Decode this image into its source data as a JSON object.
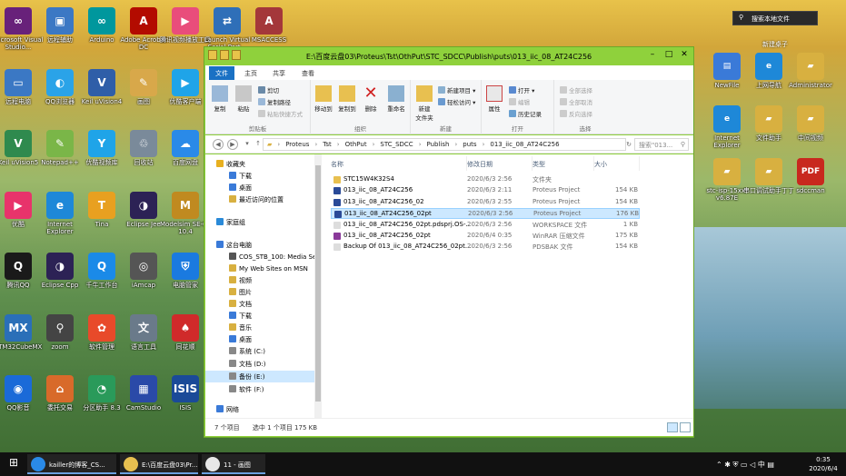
{
  "desktop": {
    "icons": [
      {
        "label": "Microsoft Visual Studio...",
        "icon": "visual-studio-icon",
        "color": "#68217a",
        "glyph": "∞"
      },
      {
        "label": "远程辅助",
        "icon": "remote-assist-icon",
        "color": "#3b78c4",
        "glyph": "▣"
      },
      {
        "label": "Arduino",
        "icon": "arduino-icon",
        "color": "#00979d",
        "glyph": "∞"
      },
      {
        "label": "Adobe Acrobat DC",
        "icon": "acrobat-icon",
        "color": "#b30b00",
        "glyph": "A"
      },
      {
        "label": "腾讯视频播放工具",
        "icon": "video-tool-icon",
        "color": "#e94d7b",
        "glyph": "▶"
      },
      {
        "label": "Launch Virtual Serial Port...",
        "icon": "serial-port-icon",
        "color": "#2f6fb8",
        "glyph": "⇄"
      },
      {
        "label": "MSACCESS",
        "icon": "access-icon",
        "color": "#a4373a",
        "glyph": "A"
      },
      {
        "label": "远程电脑",
        "icon": "computer-icon",
        "color": "#3b78c4",
        "glyph": "▭"
      },
      {
        "label": "QQ浏览器",
        "icon": "qq-browser-icon",
        "color": "#2aa3e8",
        "glyph": "◐"
      },
      {
        "label": "Keil uVision4",
        "icon": "keil4-icon",
        "color": "#2f5ea8",
        "glyph": "V"
      },
      {
        "label": "画图",
        "icon": "paint-icon",
        "color": "#d8a84a",
        "glyph": "✎"
      },
      {
        "label": "优酷客户端",
        "icon": "youku-icon",
        "color": "#1fa4e8",
        "glyph": "▶"
      },
      {
        "label": "网络",
        "icon": "network-icon",
        "color": "#3b78c4",
        "glyph": "◍"
      },
      {
        "label": "Macromedia Dreamweav...",
        "icon": "dreamweaver-icon",
        "color": "#3d9a3a",
        "glyph": "◉"
      },
      {
        "label": "Keil uVision5",
        "icon": "keil5-icon",
        "color": "#2f8a4e",
        "glyph": "V"
      },
      {
        "label": "Notepad++",
        "icon": "notepad-icon",
        "color": "#7ab648",
        "glyph": "✎"
      },
      {
        "label": "优酷视频库",
        "icon": "youku-lib-icon",
        "color": "#1fa4e8",
        "glyph": "Y"
      },
      {
        "label": "回收站",
        "icon": "recycle-bin-icon",
        "color": "#7a8a9a",
        "glyph": "♲"
      },
      {
        "label": "百度网盘",
        "icon": "baidu-netdisk-icon",
        "color": "#2a8ae8",
        "glyph": "☁"
      },
      {
        "label": "phpstudy_pro",
        "icon": "phpstudy-icon",
        "color": "#1c6fd8",
        "glyph": "P"
      },
      {
        "label": "Quartus II 13.0sp1 (64...",
        "icon": "quartus-icon",
        "color": "#2a63c2",
        "glyph": "Q"
      },
      {
        "label": "优酷",
        "icon": "youku2-icon",
        "color": "#e8336b",
        "glyph": "▶"
      },
      {
        "label": "Internet Explorer",
        "icon": "ie-icon",
        "color": "#1e88d8",
        "glyph": "e"
      },
      {
        "label": "Tina",
        "icon": "tina-icon",
        "color": "#e8a020",
        "glyph": "T"
      },
      {
        "label": "Eclipse Jee",
        "icon": "eclipse-jee-icon",
        "color": "#2c2255",
        "glyph": "◑"
      },
      {
        "label": "Modelsim SE-64 10.4",
        "icon": "modelsim-icon",
        "color": "#c08a20",
        "glyph": "M"
      },
      {
        "label": "QQ音乐",
        "icon": "qq-music-icon",
        "color": "#31c27c",
        "glyph": "♪"
      },
      {
        "label": "远程连接",
        "icon": "remote-connect-icon",
        "color": "#3b78c4",
        "glyph": "⇆"
      },
      {
        "label": "腾讯QQ",
        "icon": "qq-icon",
        "color": "#1a1a1a",
        "glyph": "Q"
      },
      {
        "label": "Eclipse Cpp",
        "icon": "eclipse-cpp-icon",
        "color": "#2c2255",
        "glyph": "◑"
      },
      {
        "label": "千牛工作台",
        "icon": "qianniu-icon",
        "color": "#1a8ae8",
        "glyph": "Q"
      },
      {
        "label": "iAmcap",
        "icon": "amcap-icon",
        "color": "#555555",
        "glyph": "◎"
      },
      {
        "label": "电脑管家",
        "icon": "pc-manager-icon",
        "color": "#1a7ae0",
        "glyph": "⛨"
      },
      {
        "label": "腾讯课堂",
        "icon": "tencent-class-icon",
        "color": "#2a9ae8",
        "glyph": "▶"
      },
      {
        "label": "同花顺远航版",
        "icon": "tonghuashun-icon",
        "color": "#d02a2a",
        "glyph": "♠"
      },
      {
        "label": "STM32CubeMX",
        "icon": "stm32cube-icon",
        "color": "#2a6fb8",
        "glyph": "MX"
      },
      {
        "label": "zoom",
        "icon": "zoom-icon",
        "color": "#444444",
        "glyph": "⚲"
      },
      {
        "label": "软件管理",
        "icon": "software-manager-icon",
        "color": "#e84a2a",
        "glyph": "✿"
      },
      {
        "label": "语言工具",
        "icon": "language-tool-icon",
        "color": "#6a7a8a",
        "glyph": "文"
      },
      {
        "label": "同花顺",
        "icon": "tonghuashun2-icon",
        "color": "#d02a2a",
        "glyph": "♠"
      },
      {
        "label": "网易有道词典",
        "icon": "youdao-icon",
        "color": "#e02a2a",
        "glyph": "有道"
      },
      {
        "label": "视频编辑专家 9.3",
        "icon": "video-editor-icon",
        "color": "#333333",
        "glyph": "◈"
      },
      {
        "label": "QQ影音",
        "icon": "qq-player-icon",
        "color": "#1a6ad8",
        "glyph": "◉"
      },
      {
        "label": "委托交易",
        "icon": "trade-icon",
        "color": "#d86a2a",
        "glyph": "⌂"
      },
      {
        "label": "分区助手 8.3",
        "icon": "partition-icon",
        "color": "#2a9a5a",
        "glyph": "◔"
      },
      {
        "label": "CamStudio",
        "icon": "camstudio-icon",
        "color": "#2a4aa8",
        "glyph": "▦"
      },
      {
        "label": "ISIS",
        "icon": "isis-icon",
        "color": "#1a4a98",
        "glyph": "ISIS"
      },
      {
        "label": "Proteus 8 Professional",
        "icon": "proteus-icon",
        "color": "#2a6ab8",
        "glyph": "P"
      }
    ],
    "right_icons": [
      {
        "label": "NewFile",
        "icon": "new-file-icon",
        "color": "#3a7ad8",
        "glyph": "▤"
      },
      {
        "label": "上网导航",
        "icon": "ie-nav-icon",
        "color": "#1e88d8",
        "glyph": "e"
      },
      {
        "label": "Administrator",
        "icon": "admin-folder-icon",
        "color": "#d8b040",
        "glyph": "▰"
      },
      {
        "label": "Internet Explorer",
        "icon": "ie2-icon",
        "color": "#1e88d8",
        "glyph": "e"
      },
      {
        "label": "文件助手",
        "icon": "file-helper-icon",
        "color": "#d8b040",
        "glyph": "▰"
      },
      {
        "label": "中间视频",
        "icon": "video-folder-icon",
        "color": "#d8b040",
        "glyph": "▰"
      },
      {
        "label": "stc-isp-15xx-v6.87E",
        "icon": "stc-isp-folder-icon",
        "color": "#d8b040",
        "glyph": "▰"
      },
      {
        "label": "串口调试助手丁丁",
        "icon": "serial-debug-folder-icon",
        "color": "#d8b040",
        "glyph": "▰"
      },
      {
        "label": "sdccman",
        "icon": "pdf-icon",
        "color": "#c8281e",
        "glyph": "PDF"
      }
    ],
    "search_box": "搜索本地文件",
    "right_title": "新建桌子"
  },
  "window": {
    "title": "E:\\百度云盘03\\Proteus\\Tst\\OthPut\\STC_SDCC\\Publish\\puts\\013_iic_08_AT24C256",
    "tabs": [
      "文件",
      "主页",
      "共享",
      "查看"
    ],
    "ribbon": {
      "groups": {
        "clipboard": "剪贴板",
        "organize": "组织",
        "new": "新建",
        "open": "打开",
        "select": "选择"
      },
      "copy": "复制",
      "paste": "粘贴",
      "cut": "剪切",
      "copy_path": "复制路径",
      "paste_shortcut": "粘贴快捷方式",
      "move_to": "移动到",
      "copy_to": "复制到",
      "delete": "删除",
      "rename": "重命名",
      "new_folder": "新建\n文件夹",
      "new_item": "新建项目",
      "easy_access": "轻松访问",
      "properties": "属性",
      "open": "打开",
      "edit": "编辑",
      "history": "历史记录",
      "select_all": "全部选择",
      "select_none": "全部取消",
      "invert": "反向选择"
    },
    "path": [
      "Proteus",
      "Tst",
      "OthPut",
      "STC_SDCC",
      "Publish",
      "puts",
      "013_iic_08_AT24C256"
    ],
    "search_placeholder": "搜索\"013...",
    "nav": [
      {
        "label": "收藏夹",
        "icon": "star-icon",
        "color": "#e8b020",
        "indent": 0
      },
      {
        "label": "下载",
        "icon": "download-icon",
        "color": "#3a7ad8",
        "indent": 1
      },
      {
        "label": "桌面",
        "icon": "desktop-icon",
        "color": "#3a7ad8",
        "indent": 1
      },
      {
        "label": "最近访问的位置",
        "icon": "recent-icon",
        "color": "#d8b040",
        "indent": 1
      },
      {
        "label": "家庭组",
        "icon": "homegroup-icon",
        "color": "#2a8ad8",
        "indent": 0
      },
      {
        "label": "这台电脑",
        "icon": "this-pc-icon",
        "color": "#3a7ad8",
        "indent": 0
      },
      {
        "label": "COS_STB_100: Media Serv",
        "icon": "media-server-icon",
        "color": "#555555",
        "indent": 1
      },
      {
        "label": "My Web Sites on MSN",
        "icon": "msn-icon",
        "color": "#d8b040",
        "indent": 1
      },
      {
        "label": "视频",
        "icon": "videos-icon",
        "color": "#d8b040",
        "indent": 1
      },
      {
        "label": "图片",
        "icon": "pictures-icon",
        "color": "#d8b040",
        "indent": 1
      },
      {
        "label": "文档",
        "icon": "documents-icon",
        "color": "#d8b040",
        "indent": 1
      },
      {
        "label": "下载",
        "icon": "downloads-icon",
        "color": "#3a7ad8",
        "indent": 1
      },
      {
        "label": "音乐",
        "icon": "music-icon",
        "color": "#d8b040",
        "indent": 1
      },
      {
        "label": "桌面",
        "icon": "desktop2-icon",
        "color": "#3a7ad8",
        "indent": 1
      },
      {
        "label": "系统 (C:)",
        "icon": "drive-c-icon",
        "color": "#888888",
        "indent": 1
      },
      {
        "label": "文档 (D:)",
        "icon": "drive-d-icon",
        "color": "#888888",
        "indent": 1
      },
      {
        "label": "备份 (E:)",
        "icon": "drive-e-icon",
        "color": "#888888",
        "indent": 1
      },
      {
        "label": "软件 (F:)",
        "icon": "drive-f-icon",
        "color": "#888888",
        "indent": 1
      },
      {
        "label": "网络",
        "icon": "network-nav-icon",
        "color": "#3a7ad8",
        "indent": 0
      }
    ],
    "columns": [
      "名称",
      "修改日期",
      "类型",
      "大小"
    ],
    "files": [
      {
        "name": "STC15W4K32S4",
        "date": "2020/6/3 2:56",
        "type": "文件夹",
        "size": "",
        "icon": "folder-icon",
        "color": "#e8c050"
      },
      {
        "name": "013_iic_08_AT24C256",
        "date": "2020/6/3 2:11",
        "type": "Proteus Project",
        "size": "154 KB",
        "icon": "proteus-file-icon",
        "color": "#2a4a98"
      },
      {
        "name": "013_iic_08_AT24C256_02",
        "date": "2020/6/3 2:55",
        "type": "Proteus Project",
        "size": "154 KB",
        "icon": "proteus-file-icon",
        "color": "#2a4a98"
      },
      {
        "name": "013_iic_08_AT24C256_02pt",
        "date": "2020/6/3 2:56",
        "type": "Proteus Project",
        "size": "176 KB",
        "icon": "proteus-file-icon",
        "color": "#2a4a98"
      },
      {
        "name": "013_iic_08_AT24C256_02pt.pdsprj.OS-...",
        "date": "2020/6/3 2:56",
        "type": "WORKSPACE 文件",
        "size": "1 KB",
        "icon": "workspace-file-icon",
        "color": "#dddddd"
      },
      {
        "name": "013_iic_08_AT24C256_02pt",
        "date": "2020/6/4 0:35",
        "type": "WinRAR 压缩文件",
        "size": "175 KB",
        "icon": "winrar-icon",
        "color": "#8a3a9a"
      },
      {
        "name": "Backup Of 013_iic_08_AT24C256_02pt...",
        "date": "2020/6/3 2:56",
        "type": "PDSBAK 文件",
        "size": "154 KB",
        "icon": "backup-file-icon",
        "color": "#dddddd"
      }
    ],
    "status_count": "7 个项目",
    "status_selected": "选中 1 个项目  175 KB"
  },
  "taskbar": {
    "items": [
      {
        "label": "kailler的博客_CS...",
        "icon": "browser-task-icon",
        "color": "#2a8ae8"
      },
      {
        "label": "E:\\百度云盘03\\Pr...",
        "icon": "explorer-task-icon",
        "color": "#e8c050"
      },
      {
        "label": "11 - 画图",
        "icon": "paint-task-icon",
        "color": "#e8e8e8"
      }
    ],
    "ime": "中",
    "time": "0:35",
    "date": "2020/6/4"
  }
}
